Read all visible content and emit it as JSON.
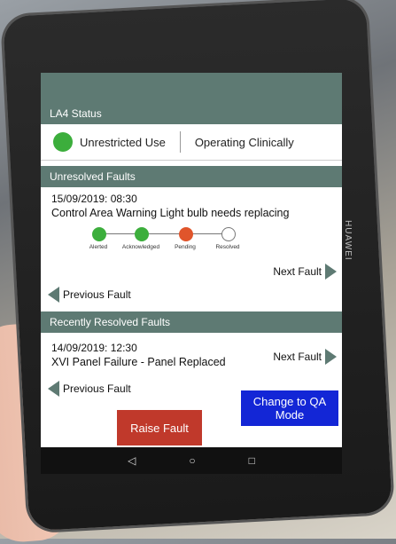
{
  "header": {
    "title": "LA4 Status"
  },
  "status": {
    "left_label": "Unrestricted Use",
    "right_label": "Operating Clinically",
    "dot_color": "#3cae3c"
  },
  "unresolved": {
    "section_title": "Unresolved Faults",
    "date": "15/09/2019: 08:30",
    "description": "Control Area Warning Light bulb needs replacing",
    "steps": [
      {
        "label": "Alerted",
        "state": "done",
        "color": "#3cae3c"
      },
      {
        "label": "Acknowledged",
        "state": "done",
        "color": "#3cae3c"
      },
      {
        "label": "Pending",
        "state": "current",
        "color": "#e0552b"
      },
      {
        "label": "Resolved",
        "state": "todo",
        "color": "#ffffff"
      }
    ],
    "next_label": "Next Fault",
    "prev_label": "Previous Fault"
  },
  "resolved": {
    "section_title": "Recently Resolved Faults",
    "date": "14/09/2019: 12:30",
    "description": "XVI Panel Failure - Panel Replaced",
    "next_label": "Next Fault",
    "prev_label": "Previous Fault"
  },
  "actions": {
    "raise_label": "Raise Fault",
    "qa_label": "Change to QA Mode",
    "raise_color": "#c0392b",
    "qa_color": "#1326d6"
  },
  "android_nav": {
    "back": "◁",
    "home": "○",
    "recents": "□"
  },
  "device_brand": "HUAWEI"
}
